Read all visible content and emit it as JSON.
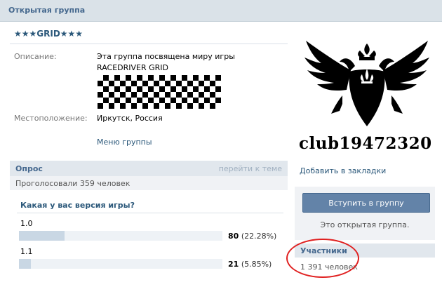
{
  "header": {
    "title": "Открытая группа"
  },
  "group": {
    "name": "★★★GRID★★★",
    "description_label": "Описание:",
    "description": "Эта группа посвящена миру игры RACEDRIVER GRID",
    "location_label": "Местоположение:",
    "location": "Иркутск, Россия",
    "menu_link": "Меню группы"
  },
  "poll": {
    "title": "Опрос",
    "goto_link": "перейти к теме",
    "voted": "Проголосовали 359 человек",
    "question": "Какая у вас версия игры?",
    "options": [
      {
        "label": "1.0",
        "count": "80",
        "percent": "(22.28%)",
        "fraction": 0.2228
      },
      {
        "label": "1.1",
        "count": "21",
        "percent": "(5.85%)",
        "fraction": 0.0585
      }
    ]
  },
  "sidebar": {
    "club_id": "club19472320",
    "bookmark_link": "Добавить в закладки",
    "join_button": "Вступить в группу",
    "open_note": "Это открытая группа.",
    "members_title": "Участники",
    "members_count": "1 391 человек"
  },
  "colors": {
    "link": "#2b587a",
    "header_text": "#45688e",
    "button": "#6383a8",
    "annotation": "#e02020"
  }
}
